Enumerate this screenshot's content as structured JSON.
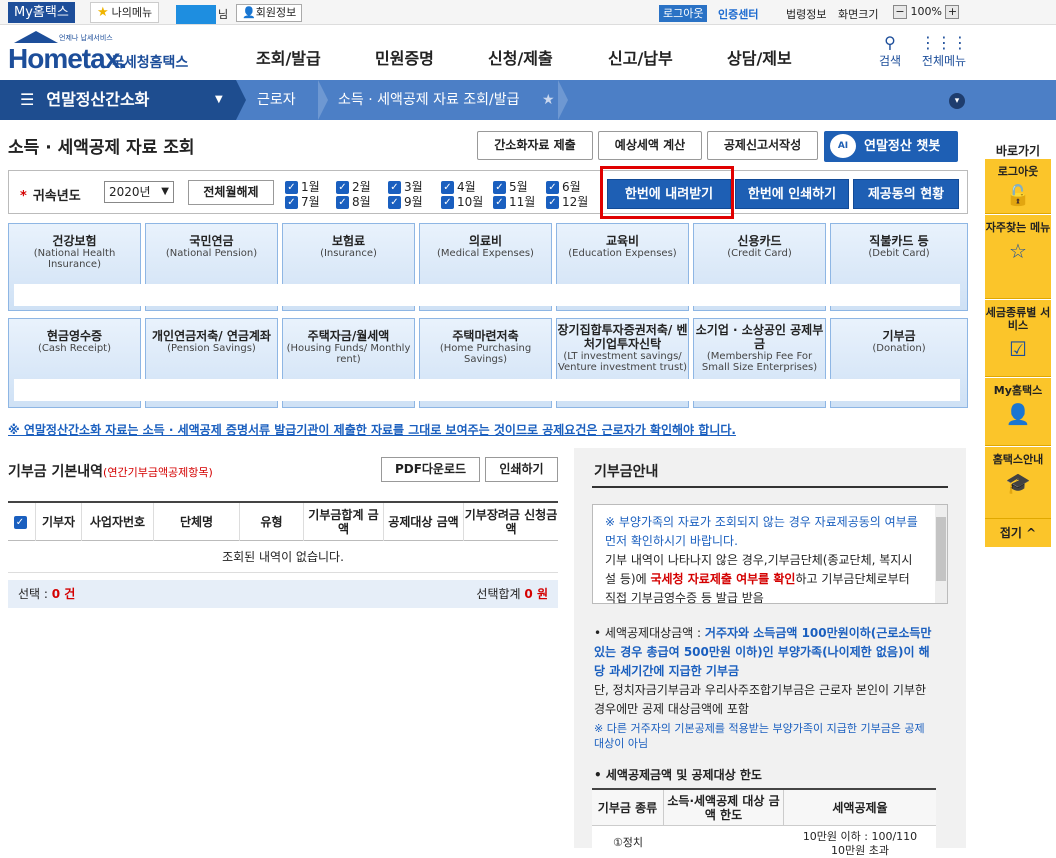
{
  "topbar": {
    "myhome": "My홈택스",
    "mymenu": "나의메뉴",
    "suffix": "님",
    "member_info": "회원정보",
    "logout": "로그아웃",
    "cert_center": "인증센터",
    "law_info": "법령정보",
    "screen_size": "화면크기",
    "zoom_minus": "−",
    "zoom": "100%",
    "zoom_plus": "+"
  },
  "header": {
    "logo_sub": "언제나 납세서비스",
    "logo_en": "Hometax.",
    "logo_kr": "국세청홈택스",
    "menu": [
      "조회/발급",
      "민원증명",
      "신청/제출",
      "신고/납부",
      "상담/제보"
    ],
    "search": "검색",
    "all_menu": "전체메뉴"
  },
  "nav": {
    "current": "연말정산간소화",
    "crumb1": "근로자",
    "crumb2": "소득 · 세액공제 자료 조회/발급"
  },
  "page": {
    "title": "소득 · 세액공제 자료 조회",
    "btn_submit": "간소화자료 제출",
    "btn_estimate": "예상세액 계산",
    "btn_report": "공제신고서작성",
    "chatbot": "연말정산 챗봇",
    "chatbot_face": "AI"
  },
  "filter": {
    "year_label": "귀속년도",
    "year_value": "2020년",
    "all_off": "전체월해제",
    "months": [
      "1월",
      "2월",
      "3월",
      "4월",
      "5월",
      "6월",
      "7월",
      "8월",
      "9월",
      "10월",
      "11월",
      "12월"
    ],
    "download_all": "한번에 내려받기",
    "print_all": "한번에 인쇄하기",
    "provider_status": "제공동의 현황"
  },
  "categories_row1": [
    {
      "kr": "건강보험",
      "en": "(National Health Insurance)"
    },
    {
      "kr": "국민연금",
      "en": "(National Pension)"
    },
    {
      "kr": "보험료",
      "en": "(Insurance)"
    },
    {
      "kr": "의료비",
      "en": "(Medical Expenses)"
    },
    {
      "kr": "교육비",
      "en": "(Education Expenses)"
    },
    {
      "kr": "신용카드",
      "en": "(Credit Card)"
    },
    {
      "kr": "직불카드 등",
      "en": "(Debit Card)"
    }
  ],
  "categories_row2": [
    {
      "kr": "현금영수증",
      "en": "(Cash Receipt)"
    },
    {
      "kr": "개인연금저축/ 연금계좌",
      "en": "(Pension Savings)"
    },
    {
      "kr": "주택자금/월세액",
      "en": "(Housing Funds/ Monthly rent)"
    },
    {
      "kr": "주택마련저축",
      "en": "(Home Purchasing Savings)"
    },
    {
      "kr": "장기집합투자증권저축/ 벤처기업투자신탁",
      "en": "(LT investment savings/ Venture investment trust)"
    },
    {
      "kr": "소기업 · 소상공인 공제부금",
      "en": "(Membership Fee For Small Size Enterprises)"
    },
    {
      "kr": "기부금",
      "en": "(Donation)"
    }
  ],
  "notice": "※ 연말정산간소화 자료는 소득 · 세액공제 증명서류 발급기관이 제출한 자료를 그대로 보여주는 것이므로 공제요건은 근로자가 확인해야 합니다.",
  "donation": {
    "title": "기부금 기본내역",
    "subtitle": "(연간기부금액공제항목)",
    "pdf": "PDF다운로드",
    "print": "인쇄하기",
    "columns": [
      "기부자",
      "사업자번호",
      "단체명",
      "유형",
      "기부금합계 금액",
      "공제대상 금액",
      "기부장려금 신청금액"
    ],
    "empty": "조회된 내역이 없습니다.",
    "selected_label": "선택 :",
    "selected_value": "0 건",
    "sum_label": "선택합계",
    "sum_value": "0 원"
  },
  "guide": {
    "title": "기부금안내",
    "box_p1": "※ 부양가족의 자료가 조회되지 않는 경우 자료제공동의 여부를 먼저 확인하시기 바랍니다.",
    "box_p2a": "기부 내역이 나타나지 않은 경우,기부금단체(종교단체, 복지시설 등)에 ",
    "box_p2b": "국세청 자료제출 여부를 확인",
    "box_p2c": "하고 기부금단체로부터 직접 기부금영수증 등 발급 받음",
    "info_a": "세액공제대상금액 : ",
    "info_b": "거주자와 소득금액 100만원이하(근로소득만 있는 경우 총급여 500만원 이하)인 부양가족(나이제한 없음)이 해당 과세기간에 지급한 기부금",
    "info_c": "단, 정치자금기부금과 우리사주조합기부금은 근로자 본인이 기부한 경우에만 공제 대상금액에 포함",
    "info_note": "※ 다른 거주자의 기본공제를 적용받는 부양가족이 지급한 기부금은 공제대상이 아님",
    "table_title": "세액공제금액 및 공제대상 한도",
    "table_cols": [
      "기부금 종류",
      "소득·세액공제 대상 금액 한도",
      "세액공제율"
    ],
    "row1_type": "①정치",
    "row1_rate": "10만원 이하 : 100/110",
    "row1_rate2": "10만원 초과"
  },
  "side": {
    "title": "바로가기",
    "items": [
      "로그아웃",
      "자주찾는 메뉴",
      "세금종류별 서비스",
      "My홈택스",
      "홈택스안내"
    ],
    "fold": "접기"
  }
}
